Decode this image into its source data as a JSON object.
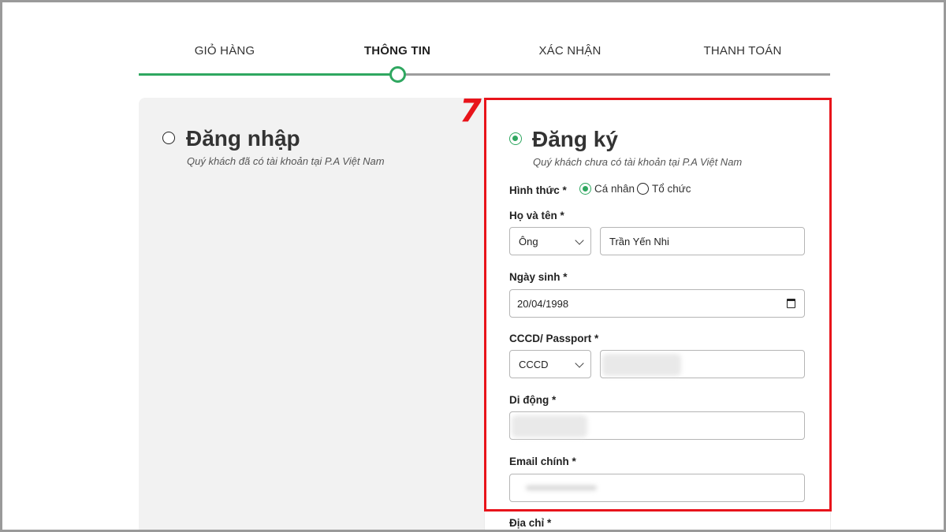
{
  "stepper": {
    "steps": [
      {
        "label": "GIỎ HÀNG",
        "active": false
      },
      {
        "label": "THÔNG TIN",
        "active": true
      },
      {
        "label": "XÁC NHẬN",
        "active": false
      },
      {
        "label": "THANH TOÁN",
        "active": false
      }
    ],
    "progress_fraction": 0.375,
    "colors": {
      "done": "#2fa760",
      "todo": "#9d9d9d"
    }
  },
  "login": {
    "title": "Đăng nhập",
    "subtitle": "Quý khách đã có tài khoản tại P.A Việt Nam",
    "selected": false
  },
  "register": {
    "step_marker": "7",
    "title": "Đăng ký",
    "subtitle": "Quý khách chưa có tài khoản tại P.A Việt Nam",
    "selected": true,
    "form": {
      "type_label": "Hình thức *",
      "type_options": [
        {
          "label": "Cá nhân",
          "selected": true
        },
        {
          "label": "Tổ chức",
          "selected": false
        }
      ],
      "name_label": "Họ và tên *",
      "salutation_value": "Ông",
      "name_value": "Trần Yến Nhi",
      "dob_label": "Ngày sinh *",
      "dob_value": "20/04/1998",
      "id_label": "CCCD/ Passport *",
      "id_type_value": "CCCD",
      "phone_label": "Di động *",
      "email_label": "Email chính *",
      "address_label": "Địa chỉ *"
    }
  },
  "colors": {
    "accent": "#2fa760",
    "highlight": "#e8141b"
  }
}
